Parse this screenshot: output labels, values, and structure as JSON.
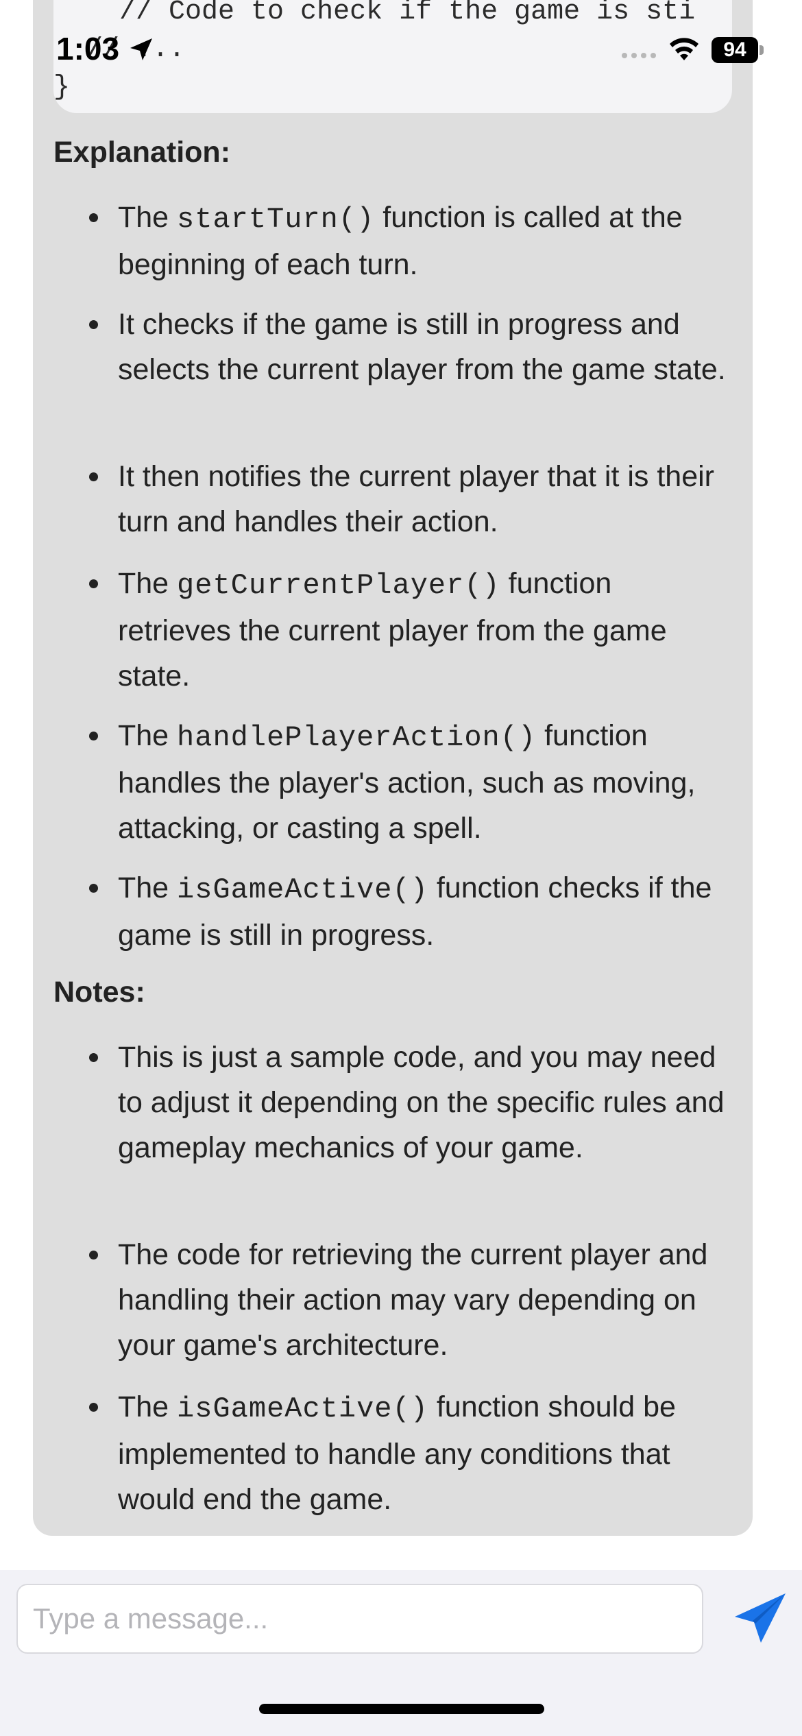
{
  "status_bar": {
    "time": "1:03",
    "battery": "94"
  },
  "code": {
    "line1": "    // Code to check if the game is sti",
    "line2": "  // ...",
    "line3": "}"
  },
  "explanation": {
    "title": "Explanation:",
    "items": [
      {
        "pre": "The ",
        "code": "startTurn()",
        "post": " function is called at the beginning of each turn."
      },
      {
        "pre": "It checks if the game is still in progress and selects the current player from the game state.",
        "code": "",
        "post": ""
      },
      {
        "pre": "It then notifies the current player that it is their turn and handles their action.",
        "code": "",
        "post": ""
      },
      {
        "pre": "The ",
        "code": "getCurrentPlayer()",
        "post": " function retrieves the current player from the game state."
      },
      {
        "pre": "The ",
        "code": "handlePlayerAction()",
        "post": " function handles the player's action, such as moving, attacking, or casting a spell."
      },
      {
        "pre": "The ",
        "code": "isGameActive()",
        "post": " function checks if the game is still in progress."
      }
    ]
  },
  "notes": {
    "title": "Notes:",
    "items": [
      {
        "pre": "This is just a sample code, and you may need to adjust it depending on the specific rules and gameplay mechanics of your game.",
        "code": "",
        "post": ""
      },
      {
        "pre": "The code for retrieving the current player and handling their action may vary depending on your game's architecture.",
        "code": "",
        "post": ""
      },
      {
        "pre": "The ",
        "code": "isGameActive()",
        "post": " function should be implemented to handle any conditions that would end the game."
      }
    ]
  },
  "composer": {
    "placeholder": "Type a message..."
  },
  "colors": {
    "accent": "#1a73e8",
    "bubble": "#dedede",
    "code_bg": "#f4f4f6"
  }
}
